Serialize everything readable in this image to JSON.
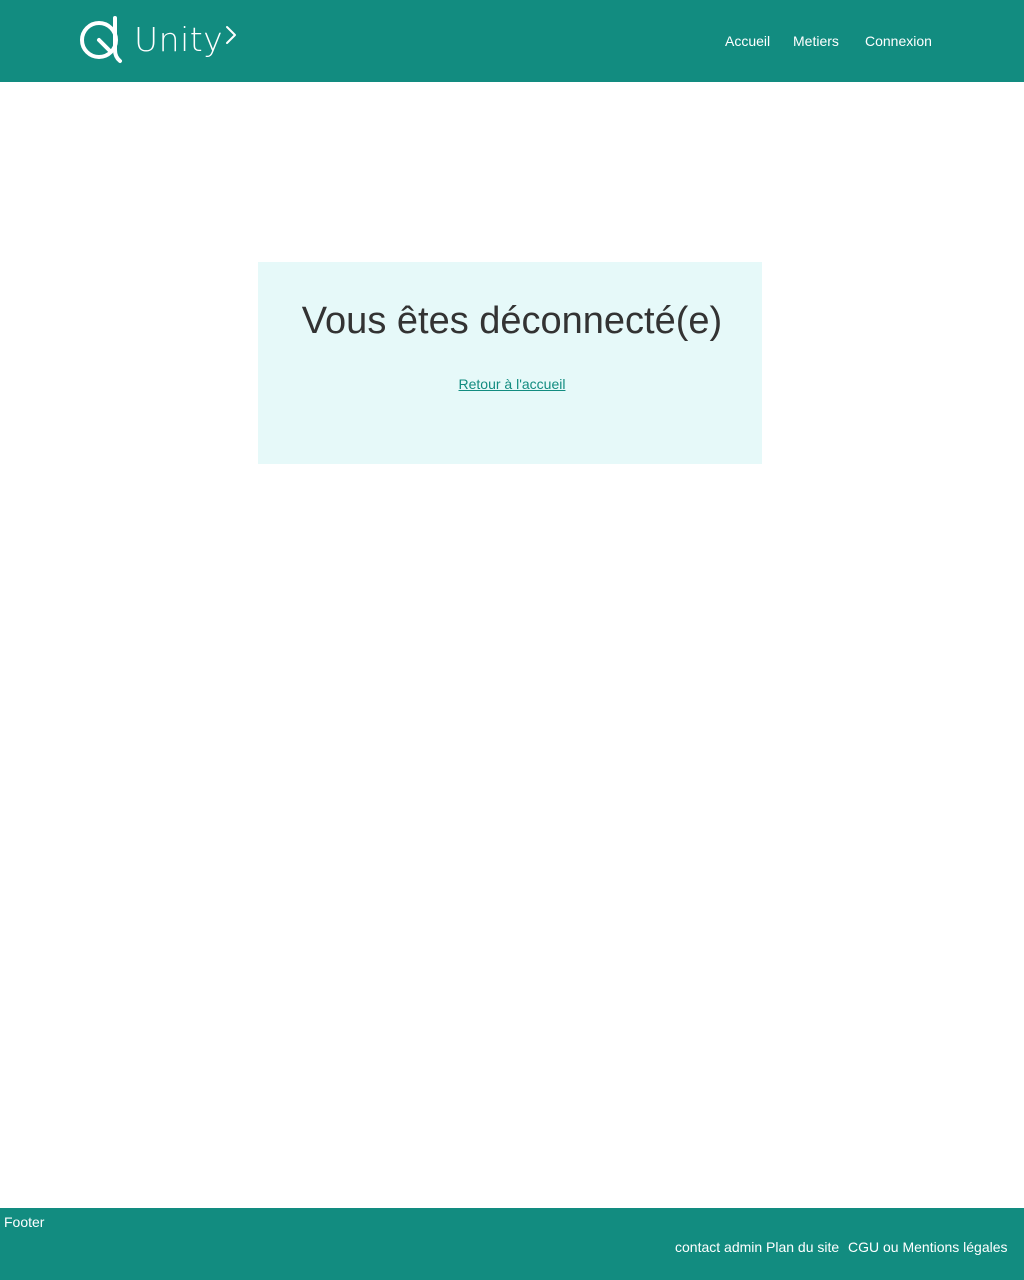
{
  "colors": {
    "brand": "#128c80",
    "card_background": "#e6f9f9",
    "title_text": "#333333",
    "link": "#128c80",
    "header_text": "#ffffff"
  },
  "header": {
    "logo_text": "Unity",
    "logo_icon": "unity-q-logo-icon",
    "chevron_icon": "chevron-right-icon",
    "nav": {
      "accueil": "Accueil",
      "metiers": "Metiers",
      "connexion": "Connexion"
    }
  },
  "main": {
    "title": "Vous êtes déconnecté(e)",
    "back_link": "Retour à l'accueil"
  },
  "footer": {
    "label": "Footer",
    "links": {
      "contact": "contact admin",
      "plan": "Plan du site",
      "cgu": "CGU ou Mentions légales"
    }
  }
}
